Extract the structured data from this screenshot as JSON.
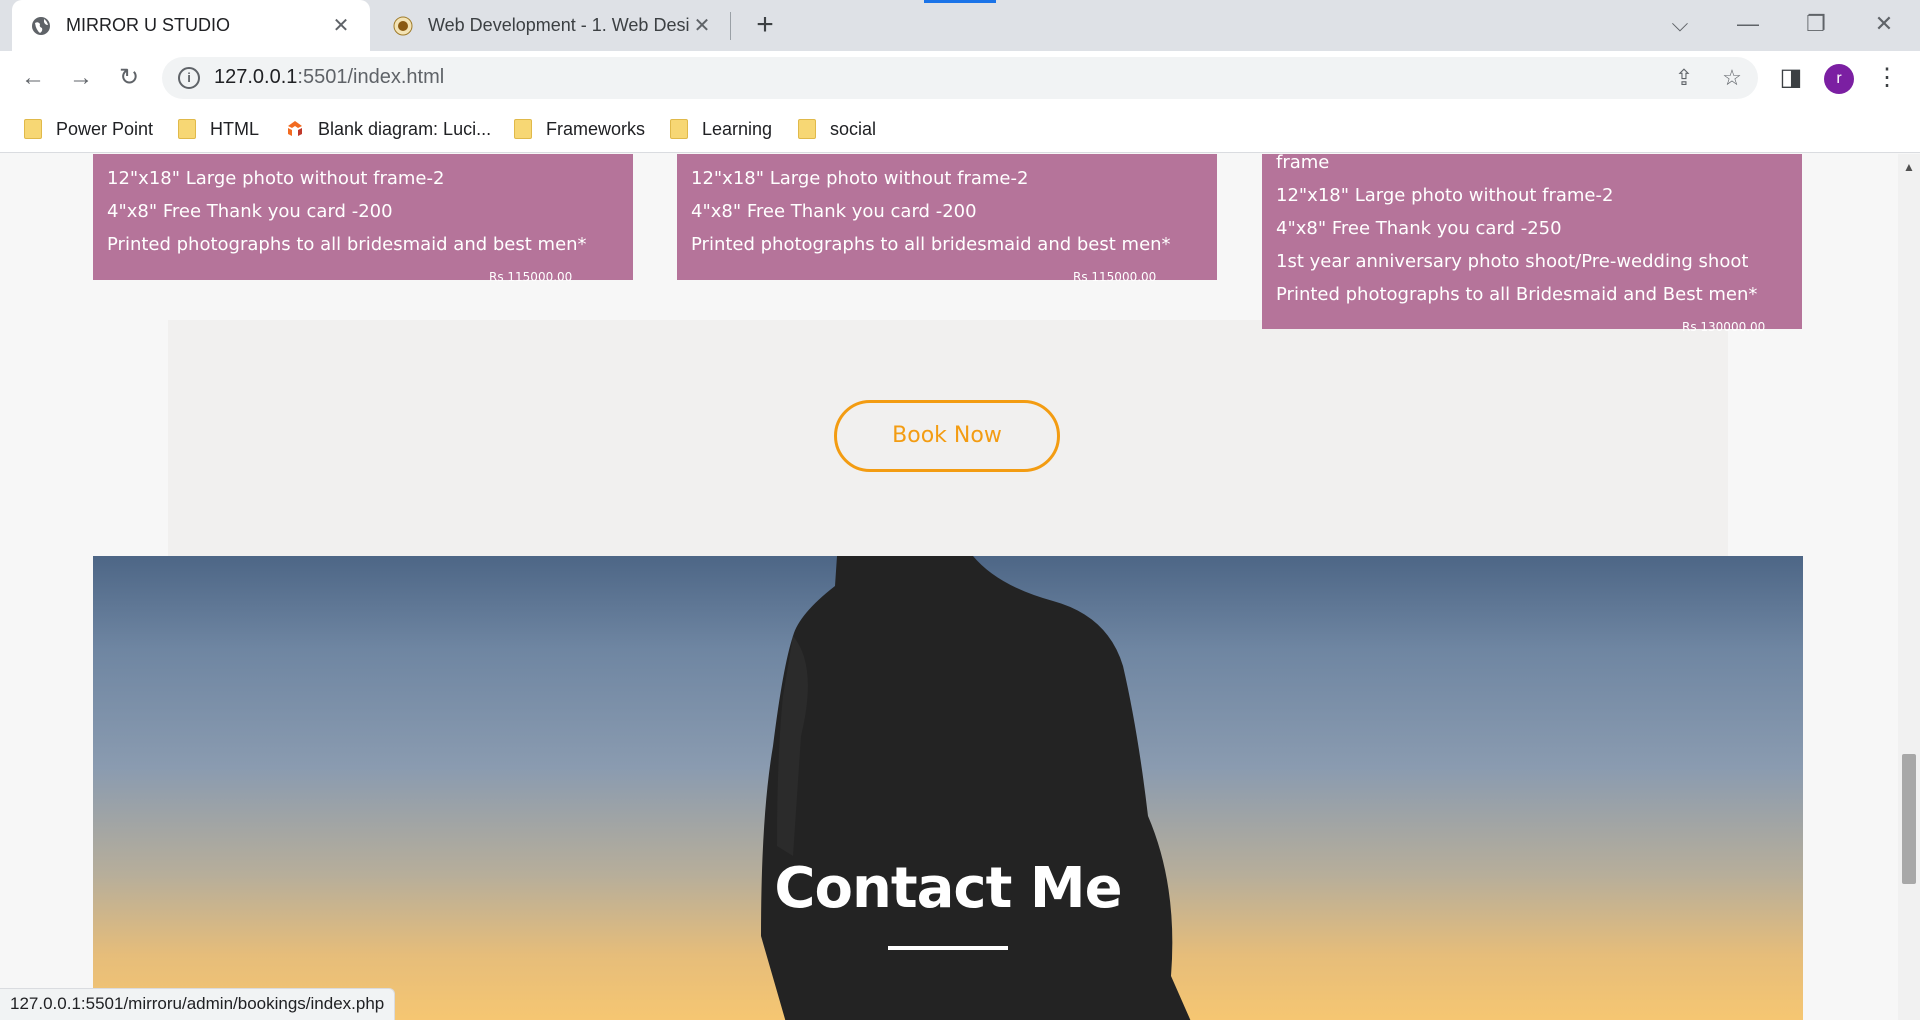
{
  "browser": {
    "tabs": [
      {
        "title": "MIRROR U STUDIO",
        "active": true
      },
      {
        "title": "Web Development - 1. Web Desi",
        "active": false
      }
    ],
    "address": {
      "host": "127.0.0.1",
      "path": ":5501/index.html"
    },
    "bookmarks": [
      {
        "label": "Power Point",
        "icon": "folder-icon"
      },
      {
        "label": "HTML",
        "icon": "folder-icon"
      },
      {
        "label": "Blank diagram: Luci...",
        "icon": "lucidchart-icon"
      },
      {
        "label": "Frameworks",
        "icon": "folder-icon"
      },
      {
        "label": "Learning",
        "icon": "folder-icon"
      },
      {
        "label": "social",
        "icon": "folder-icon"
      }
    ],
    "avatar_letter": "r",
    "status_url": "127.0.0.1:5501/mirroru/admin/bookings/index.php"
  },
  "packages": [
    {
      "lines": [
        "12\"x18\" Large photo without frame-2",
        "4\"x8\" Free Thank you card -200",
        "Printed photographs to all bridesmaid and best men*"
      ],
      "price": "Rs 115000.00"
    },
    {
      "lines": [
        "12\"x18\" Large photo without frame-2",
        "4\"x8\" Free Thank you card -200",
        "Printed photographs to all bridesmaid and best men*"
      ],
      "price": "Rs 115000.00"
    },
    {
      "lines": [
        "frame",
        "12\"x18\" Large photo without frame-2",
        "4\"x8\" Free Thank you card -250",
        "1st year anniversary photo shoot/Pre-wedding shoot",
        "Printed photographs to all Bridesmaid and Best men*"
      ],
      "price": "Rs 130000.00"
    }
  ],
  "book_now_label": "Book Now",
  "contact": {
    "title": "Contact Me"
  },
  "colors": {
    "card": "#b5749a",
    "accent": "#f39c12",
    "tab_bar": "#dee1e6",
    "avatar": "#7b1fa2"
  }
}
